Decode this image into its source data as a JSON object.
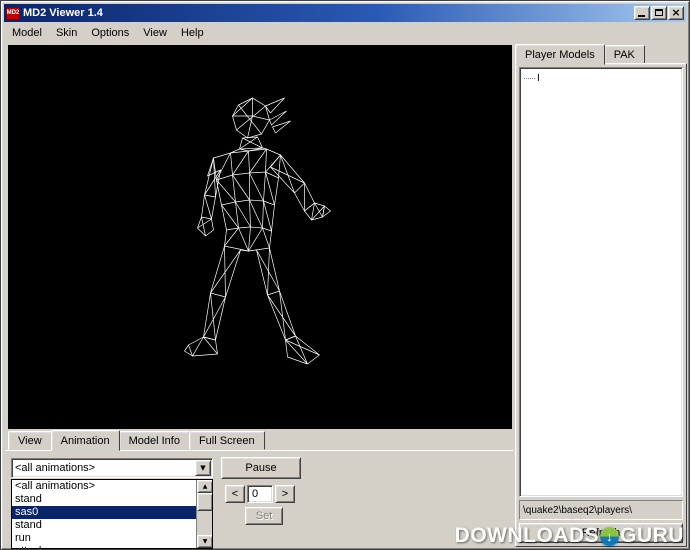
{
  "window": {
    "title": "MD2 Viewer 1.4",
    "icon_text": "MD2"
  },
  "menu_bar": {
    "items": [
      "Model",
      "Skin",
      "Options",
      "View",
      "Help"
    ]
  },
  "bottom_panel": {
    "tab_view": "View",
    "tab_animation": "Animation",
    "tab_model_info": "Model Info",
    "tab_full_screen": "Full Screen",
    "animation_combo_value": "<all animations>",
    "pause_button": "Pause",
    "list_items": [
      "<all animations>",
      "stand",
      "sas0",
      "stand",
      "run",
      "attack"
    ],
    "selected_item": "sas0",
    "prev_button": "<",
    "next_button": ">",
    "frame_value": "0",
    "set_button": "Set"
  },
  "right_panel": {
    "tab_player_models": "Player Models",
    "tab_pak": "PAK",
    "tree_node": "I",
    "path_text": "\\quake2\\baseq2\\players\\",
    "refresh_button": "Refresh"
  },
  "icons": {
    "combo_arrow": "▼",
    "scroll_up": "▲",
    "scroll_down": "▼",
    "logo_arrow": "↓",
    "close_glyph": "×"
  },
  "watermark": {
    "word1": "DOWNLOADS",
    "word2": "GURU"
  },
  "colors": {
    "chrome": "#d4d0c8",
    "title_gradient_start": "#0a246a",
    "title_gradient_end": "#a6caf0",
    "selection": "#0a246a",
    "viewport_bg": "#000000",
    "wireframe": "#ffffff"
  }
}
